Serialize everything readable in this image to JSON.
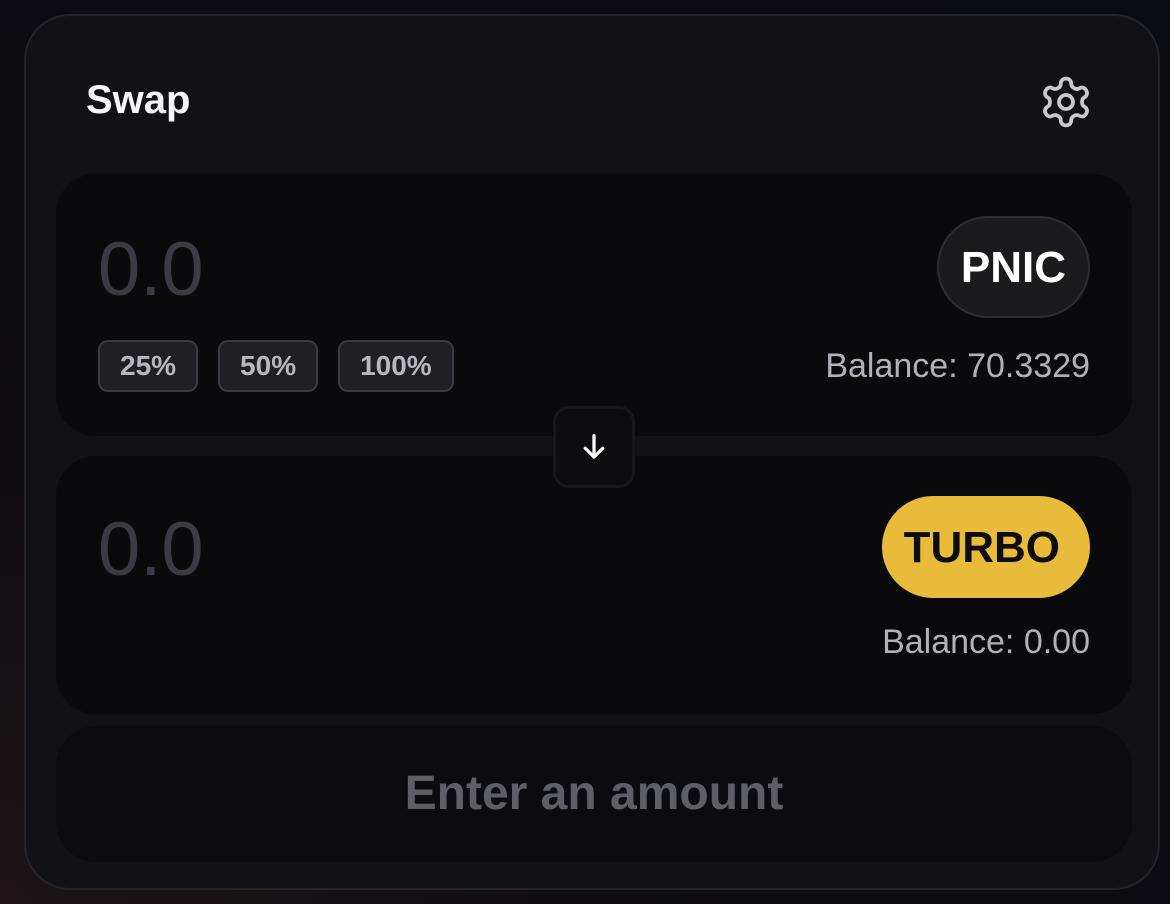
{
  "swap": {
    "title": "Swap",
    "from": {
      "amount_placeholder": "0.0",
      "token": "PNIC",
      "balance": "Balance: 70.3329",
      "percent_buttons": [
        "25%",
        "50%",
        "100%"
      ]
    },
    "to": {
      "amount_placeholder": "0.0",
      "token": "TURBO",
      "balance": "Balance: 0.00"
    },
    "action_label": "Enter an amount"
  },
  "icons": {
    "settings": "gear-icon",
    "switch": "arrow-down-icon"
  },
  "colors": {
    "accent_turbo": "#e8bb3b",
    "card_bg": "#121116",
    "panel_bg": "#0a0a0d"
  }
}
